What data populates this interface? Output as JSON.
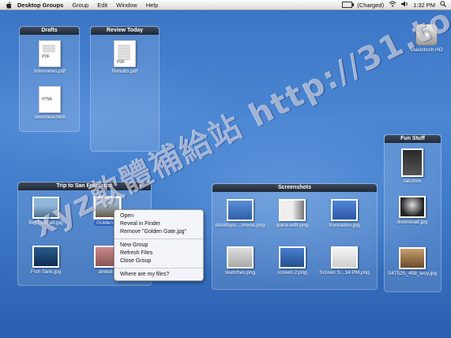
{
  "menubar": {
    "app_name": "Desktop Groups",
    "menus": [
      "Group",
      "Edit",
      "Window",
      "Help"
    ],
    "battery": "(Charged)",
    "time": "1:32 PM"
  },
  "desktop": {
    "hd_label": "Macintosh HD"
  },
  "groups": {
    "drafts": {
      "title": "Drafts",
      "files": [
        {
          "name": "Interviews.pdf",
          "tag": "PDF"
        },
        {
          "name": "overview.html",
          "tag": "HTML"
        }
      ]
    },
    "review": {
      "title": "Review Today",
      "files": [
        {
          "name": "Results.pdf",
          "tag": "PDF"
        }
      ]
    },
    "fun": {
      "title": "Fun Stuff",
      "files": [
        {
          "name": "cat.mov"
        },
        {
          "name": "download.jpg"
        },
        {
          "name": "S47525_458_lucy.jpg"
        }
      ]
    },
    "trip": {
      "title": "Trip to San Francisco",
      "menu_glyph": "▼",
      "files": [
        {
          "name": "Big Seagull.jpg"
        },
        {
          "name": "Golden G"
        },
        {
          "name": "Fish Tank.jpg"
        },
        {
          "name": "ainted L"
        }
      ]
    },
    "shots": {
      "title": "Screenshots",
      "files": [
        {
          "name": "desktops....menu.png"
        },
        {
          "name": "quick-edit.png"
        },
        {
          "name": "truncation.jpg"
        },
        {
          "name": "sketches.png"
        },
        {
          "name": "screen 2.png"
        },
        {
          "name": "Screen S...14 PM.png"
        }
      ]
    }
  },
  "context_menu": {
    "items": [
      "Open",
      "Reveal in Finder",
      "Remove \"Golden Gate.jpg\"",
      "New Group",
      "Refresh Files",
      "Close Group",
      "Where are my files?"
    ]
  },
  "watermark": "xyz軟體補給站 http://31.to",
  "colors": {
    "accent": "#2e63c7",
    "desktop": "#3f7bc9"
  }
}
